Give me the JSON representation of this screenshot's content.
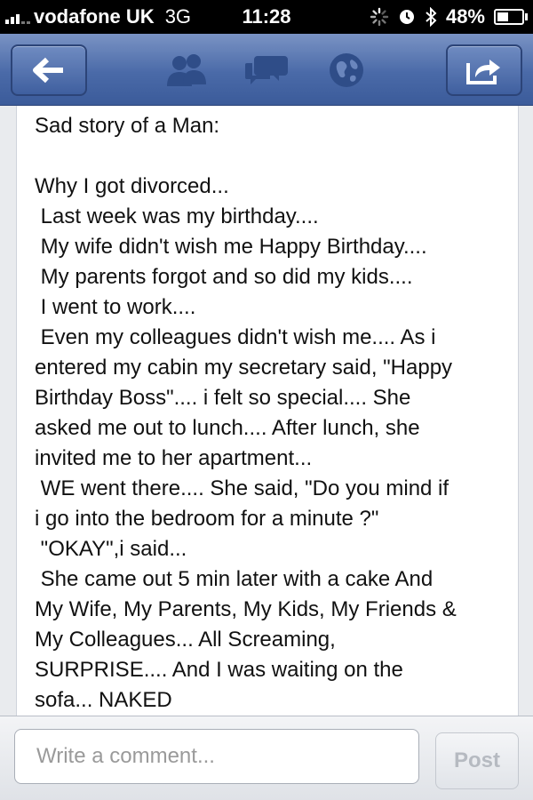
{
  "status_bar": {
    "carrier": "vodafone UK",
    "network": "3G",
    "time": "11:28",
    "battery": "48%",
    "battery_level": 0.48,
    "icons": [
      "signal-icon",
      "activity-spinner-icon",
      "alarm-icon",
      "bluetooth-icon",
      "battery-icon"
    ]
  },
  "nav": {
    "back_icon": "back-arrow-icon",
    "icons": [
      "friends-icon",
      "messages-icon",
      "notifications-globe-icon"
    ],
    "share_icon": "share-icon"
  },
  "post": {
    "lines": [
      "Sad story of a Man:",
      "",
      "Why I got divorced...",
      " Last week was my birthday....",
      " My wife didn't wish me Happy Birthday....",
      " My parents forgot and so did my kids....",
      " I went to work....",
      " Even my colleagues didn't wish me.... As i",
      "entered my cabin my secretary said, \"Happy",
      "Birthday Boss\".... i felt so special.... She",
      "asked me out to lunch.... After lunch, she",
      "invited me to her apartment...",
      " WE went there.... She said, \"Do you mind if",
      "i go into the bedroom for a minute ?\"",
      " \"OKAY\",i said...",
      " She came out 5 min later with a cake And",
      "My Wife, My Parents, My Kids, My Friends &",
      "My Colleagues... All Screaming,",
      "SURPRISE.... And I was waiting on the",
      "sofa... NAKED"
    ]
  },
  "comment_bar": {
    "placeholder": "Write a comment...",
    "value": "",
    "post_label": "Post"
  },
  "colors": {
    "nav_blue": "#4a6aa8",
    "text": "#111111",
    "post_button_text": "#b6bac1"
  }
}
